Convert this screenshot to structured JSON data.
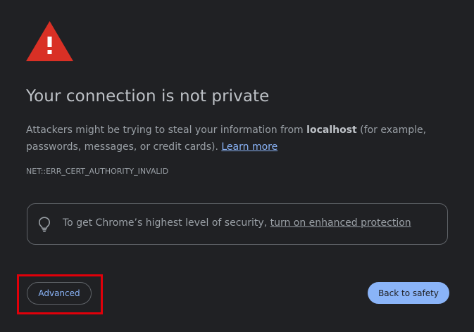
{
  "page": {
    "title": "Your connection is not private",
    "description_before": "Attackers might be trying to steal your information from ",
    "host": "localhost",
    "description_after": " (for example, passwords, messages, or credit cards). ",
    "learn_more": "Learn more",
    "error_code": "NET::ERR_CERT_AUTHORITY_INVALID"
  },
  "enhanced_protection": {
    "text": "To get Chrome’s highest level of security, ",
    "link": "turn on enhanced protection",
    "icon": "lightbulb-icon"
  },
  "buttons": {
    "advanced": "Advanced",
    "back_to_safety": "Back to safety"
  },
  "icons": {
    "warning": "warning-triangle-icon"
  },
  "colors": {
    "background": "#202124",
    "warning_red": "#d93025",
    "accent_blue": "#8ab4f8",
    "annotation_red": "#e0000a"
  }
}
